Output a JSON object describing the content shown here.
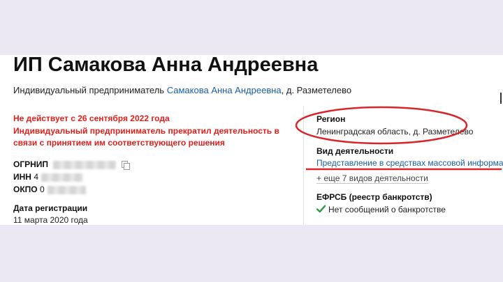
{
  "company": {
    "title": "ИП Самакова Анна Андреевна",
    "subtitle_prefix": "Индивидуальный предприниматель",
    "owner_link": "Самакова Анна Андреевна",
    "subtitle_suffix": ", д. Разметелево"
  },
  "status": {
    "line1": "Не действует с 26 сентября 2022 года",
    "line2": "Индивидуальный предприниматель прекратил деятельность в связи с принятием им соответствующего решения"
  },
  "identifiers": {
    "ogrnip_label": "ОГРНИП",
    "inn_label": "ИНН",
    "inn_value_visible": "4",
    "okpo_label": "ОКПО",
    "okpo_value_visible": "0"
  },
  "registration": {
    "label": "Дата регистрации",
    "value": "11 марта 2020 года"
  },
  "region": {
    "label": "Регион",
    "value": "Ленинградская область, д. Разметелево"
  },
  "activity": {
    "label": "Вид деятельности",
    "main_link": "Представление в средствах массовой информации",
    "more_link": "+ еще 7 видов деятельности"
  },
  "efrsb": {
    "label": "ЕФРСБ (реестр банкротств)",
    "value": "Нет сообщений о банкротстве"
  },
  "colors": {
    "page_background": "#ece8f3",
    "status_red": "#e0201b",
    "link_blue": "#1a5fa8",
    "annotation_red": "#d9252a",
    "check_green": "#2e9b43"
  },
  "icons": {
    "copy": "copy-icon",
    "check": "check-icon"
  }
}
